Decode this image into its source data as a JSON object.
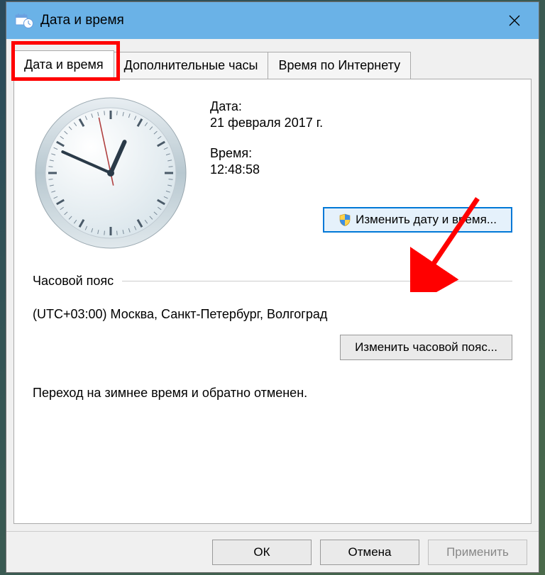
{
  "window": {
    "title": "Дата и время"
  },
  "tabs": [
    {
      "label": "Дата и время",
      "active": true
    },
    {
      "label": "Дополнительные часы",
      "active": false
    },
    {
      "label": "Время по Интернету",
      "active": false
    }
  ],
  "datetime": {
    "date_label": "Дата:",
    "date_value": "21 февраля 2017 г.",
    "time_label": "Время:",
    "time_value": "12:48:58",
    "change_button": "Изменить дату и время..."
  },
  "timezone": {
    "section_label": "Часовой пояс",
    "value": "(UTC+03:00) Москва, Санкт-Петербург, Волгоград",
    "change_button": "Изменить часовой пояс..."
  },
  "dst_note": "Переход на зимнее время и обратно отменен.",
  "footer": {
    "ok": "ОК",
    "cancel": "Отмена",
    "apply": "Применить"
  },
  "clock": {
    "hour": 12,
    "minute": 48,
    "second": 58
  }
}
